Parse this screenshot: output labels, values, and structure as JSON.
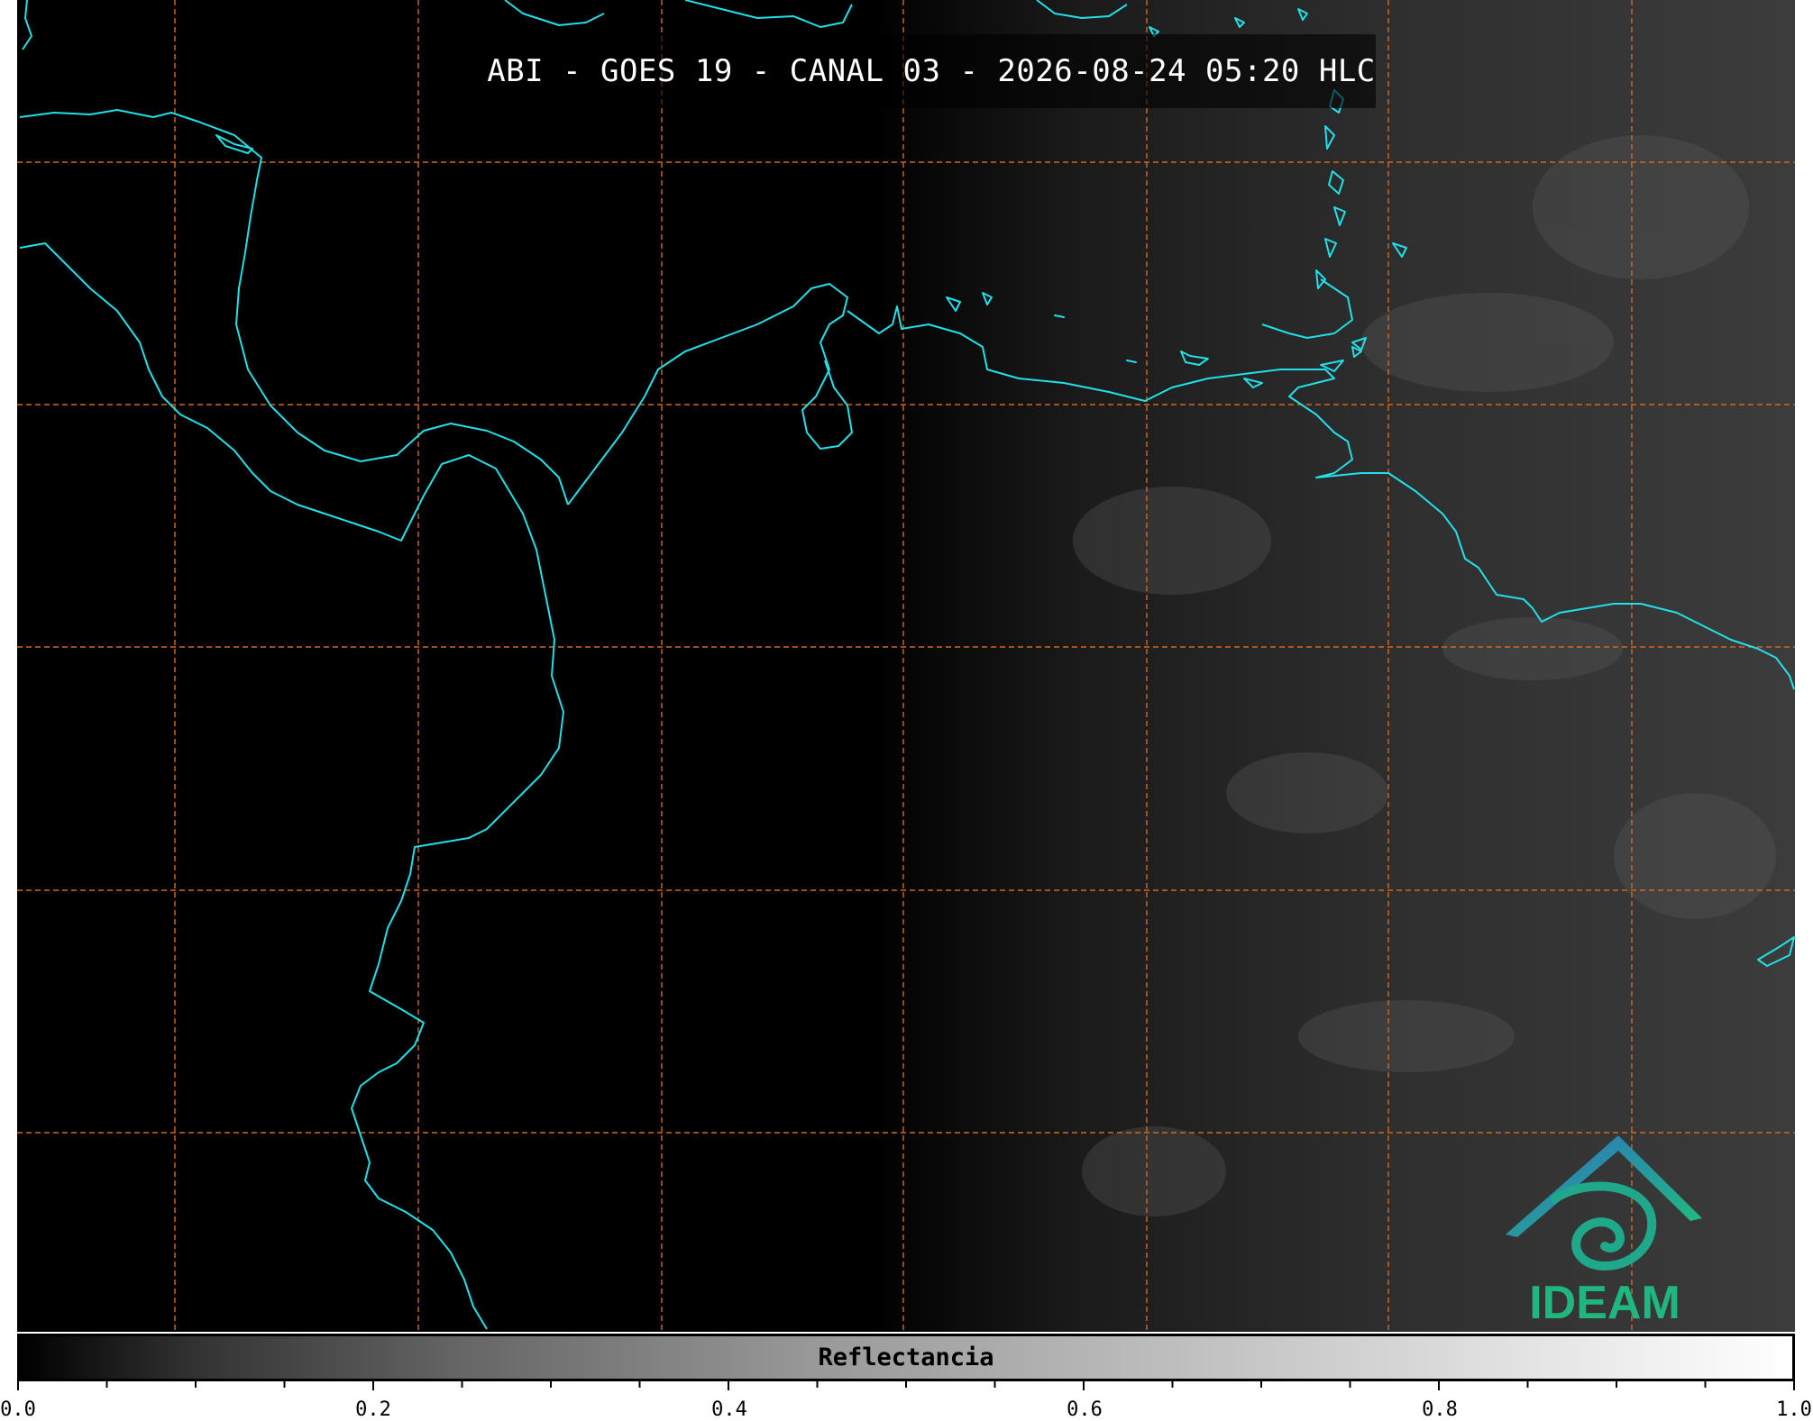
{
  "title": "ABI - GOES 19 - CANAL 03 - 2026-08-24 05:20 HLC",
  "colorbar": {
    "label": "Reflectancia",
    "tick_labels": [
      "0.0",
      "0.2",
      "0.4",
      "0.6",
      "0.8",
      "1.0"
    ],
    "range": [
      0.0,
      1.0
    ]
  },
  "logo": {
    "text": "IDEAM"
  },
  "colors": {
    "coastline": "#22e0e8",
    "grid": "#d2691e",
    "logo_blue": "#2f7fc1",
    "logo_green": "#1fb77f"
  }
}
